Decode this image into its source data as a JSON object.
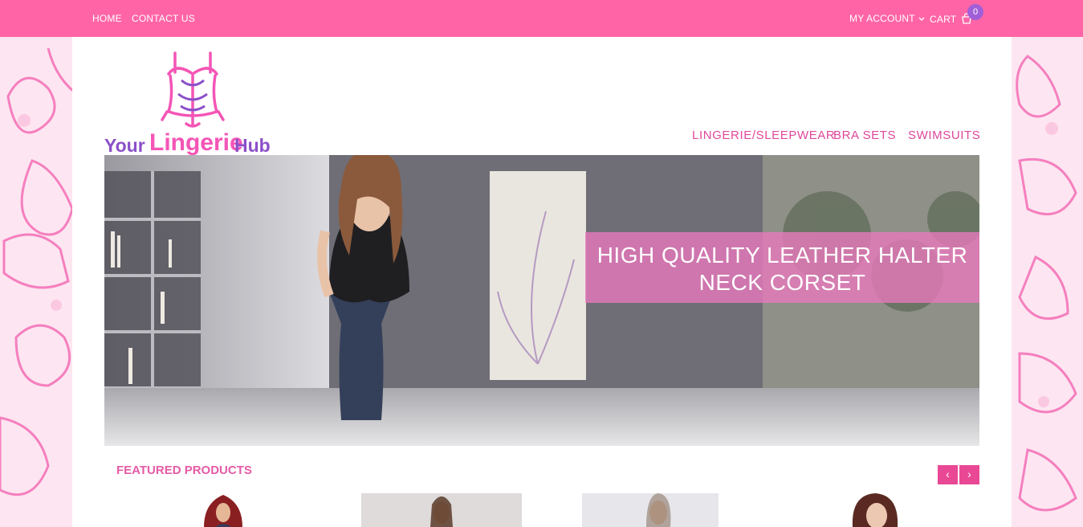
{
  "topbar": {
    "home": "HOME",
    "contact": "CONTACT US",
    "account": "MY ACCOUNT",
    "cart": "CART",
    "cart_count": "0"
  },
  "logo": {
    "your": "Your",
    "lingerie": "Lingerie",
    "hub": "Hub"
  },
  "nav": {
    "item1": "LINGERIE/SLEEPWEAR",
    "item2": "BRA SETS",
    "item3": "SWIMSUITS"
  },
  "hero": {
    "caption_line1": "HIGH QUALITY LEATHER HALTER",
    "caption_line2": "NECK CORSET"
  },
  "featured": {
    "title": "FEATURED PRODUCTS",
    "prev": "‹",
    "next": "›"
  },
  "colors": {
    "topbar": "#ff65a6",
    "accent": "#e94895",
    "purple": "#8b4fc9",
    "badge": "#a05fd6"
  }
}
